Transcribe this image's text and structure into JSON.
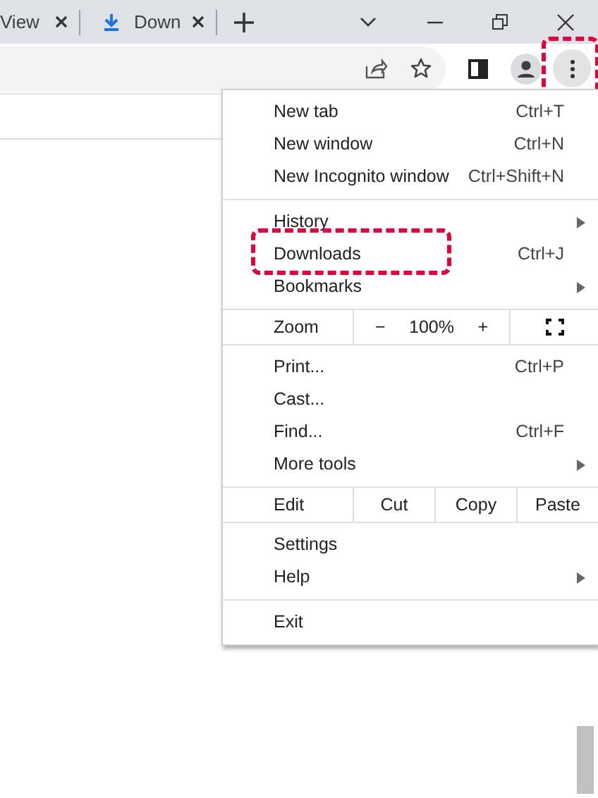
{
  "tabs": [
    {
      "title": "View"
    },
    {
      "title": "Down"
    }
  ],
  "toolbar": {
    "menu_button_highlighted": true
  },
  "menu": {
    "sections": [
      {
        "kind": "items",
        "items": [
          {
            "label": "New tab",
            "shortcut": "Ctrl+T",
            "submenu": false,
            "highlighted": false
          },
          {
            "label": "New window",
            "shortcut": "Ctrl+N",
            "submenu": false,
            "highlighted": false
          },
          {
            "label": "New Incognito window",
            "shortcut": "Ctrl+Shift+N",
            "submenu": false,
            "highlighted": false
          }
        ]
      },
      {
        "kind": "items",
        "items": [
          {
            "label": "History",
            "submenu": true,
            "highlighted": false
          },
          {
            "label": "Downloads",
            "shortcut": "Ctrl+J",
            "submenu": false,
            "highlighted": true
          },
          {
            "label": "Bookmarks",
            "submenu": true,
            "highlighted": false
          }
        ]
      },
      {
        "kind": "zoom",
        "label": "Zoom",
        "minus": "−",
        "value": "100%",
        "plus": "+"
      },
      {
        "kind": "items",
        "items": [
          {
            "label": "Print...",
            "shortcut": "Ctrl+P",
            "submenu": false,
            "highlighted": false
          },
          {
            "label": "Cast...",
            "submenu": false,
            "highlighted": false
          },
          {
            "label": "Find...",
            "shortcut": "Ctrl+F",
            "submenu": false,
            "highlighted": false
          },
          {
            "label": "More tools",
            "submenu": true,
            "highlighted": false
          }
        ]
      },
      {
        "kind": "edit",
        "label": "Edit",
        "buttons": [
          "Cut",
          "Copy",
          "Paste"
        ]
      },
      {
        "kind": "items",
        "items": [
          {
            "label": "Settings",
            "submenu": false,
            "highlighted": false
          },
          {
            "label": "Help",
            "submenu": true,
            "highlighted": false
          }
        ]
      },
      {
        "kind": "items",
        "items": [
          {
            "label": "Exit",
            "submenu": false,
            "highlighted": false
          }
        ]
      }
    ]
  }
}
